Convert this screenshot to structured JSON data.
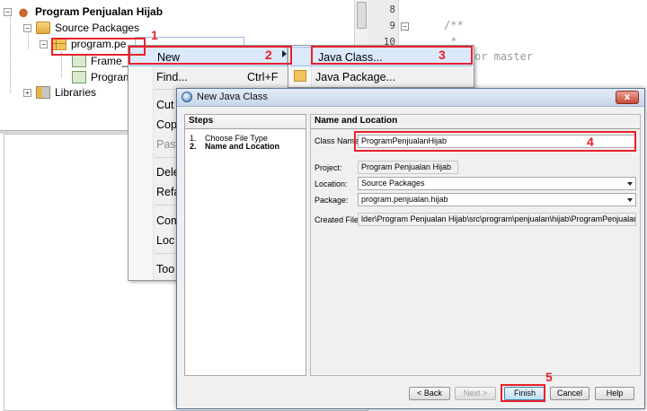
{
  "tree": {
    "project": "Program Penjualan Hijab",
    "source_packages": "Source Packages",
    "package": "program.pe",
    "file1": "Frame_",
    "file2": "Program",
    "libraries": "Libraries"
  },
  "editor": {
    "line_numbers": [
      "8",
      "9",
      "10"
    ],
    "line9": "/**",
    "line10": " *",
    "comment_tail": "or master"
  },
  "context_menu": {
    "items": [
      {
        "label": "New",
        "shortcut": ""
      },
      {
        "label": "Find...",
        "shortcut": "Ctrl+F"
      },
      {
        "label": "Cut",
        "shortcut": ""
      },
      {
        "label": "Cop",
        "shortcut": ""
      },
      {
        "label": "Past",
        "shortcut": ""
      },
      {
        "label": "Dele",
        "shortcut": ""
      },
      {
        "label": "Refa",
        "shortcut": ""
      },
      {
        "label": "Com",
        "shortcut": ""
      },
      {
        "label": "Loc",
        "shortcut": ""
      },
      {
        "label": "Too",
        "shortcut": ""
      }
    ]
  },
  "submenu": {
    "items": [
      "Java Class...",
      "Java Package..."
    ]
  },
  "dialog": {
    "title": "New Java Class",
    "close_label": "x",
    "steps_header": "Steps",
    "steps": [
      {
        "n": "1.",
        "label": "Choose File Type"
      },
      {
        "n": "2.",
        "label": "Name and Location"
      }
    ],
    "form_header": "Name and Location",
    "fields": {
      "class_name_label": "Class Name:",
      "class_name_value": "ProgramPenjualanHijab",
      "project_label": "Project:",
      "project_value": "Program Penjualan Hijab",
      "location_label": "Location:",
      "location_value": "Source Packages",
      "package_label": "Package:",
      "package_value": "program.penjualan.hijab",
      "created_file_label": "Created File:",
      "created_file_value": "lder\\Program Penjualan Hijab\\src\\program\\penjualan\\hijab\\ProgramPenjualanHijabo.java"
    },
    "buttons": {
      "back": "< Back",
      "next": "Next >",
      "finish": "Finish",
      "cancel": "Cancel",
      "help": "Help"
    }
  },
  "annotations": [
    "1",
    "2",
    "3",
    "4",
    "5"
  ],
  "colors": {
    "annotation_red": "#e8202a",
    "selection_bg": "#dbe9fb",
    "selection_border": "#99c0ee"
  }
}
